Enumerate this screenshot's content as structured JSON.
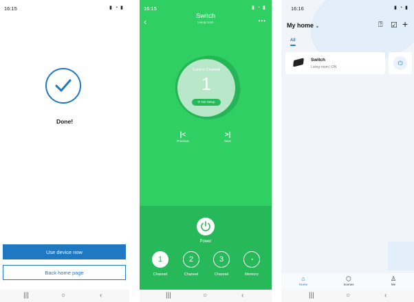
{
  "colors": {
    "brand_blue": "#1e78c2",
    "switch_green": "#2fcf63",
    "switch_green_dark": "#27b85a"
  },
  "screen_done": {
    "status_time": "16:15",
    "title": "Done!",
    "primary_button": "Use device now",
    "secondary_button": "Back home page"
  },
  "screen_switch": {
    "status_time": "16:15",
    "title": "Switch",
    "subtitle": "Living room",
    "current_channel_label": "Current Channel",
    "current_channel_value": "1",
    "setup_badge": "Not Setup",
    "previous_label": "Previous",
    "next_label": "Next",
    "power_label": "Power",
    "channels": [
      {
        "number": "1",
        "label": "Channel"
      },
      {
        "number": "2",
        "label": "Channel"
      },
      {
        "number": "3",
        "label": "Channel"
      }
    ],
    "memory_label": "Memory"
  },
  "screen_home": {
    "status_time": "16:16",
    "home_title": "My home",
    "tab_all": "All",
    "device": {
      "name": "Switch",
      "status": "Living room | ON"
    },
    "bottom_tabs": {
      "home": "Home",
      "scenes": "Scenes",
      "me": "Me"
    }
  },
  "icons": {
    "nav": [
      "recent-apps-icon",
      "home-circle-icon",
      "back-chevron-icon"
    ],
    "switch": [
      "back-icon",
      "more-icon",
      "previous-icon",
      "next-icon",
      "power-icon",
      "memory-icon"
    ],
    "home": [
      "help-icon",
      "edit-icon",
      "add-icon",
      "power-icon",
      "home-icon",
      "scenes-icon",
      "me-icon"
    ]
  }
}
